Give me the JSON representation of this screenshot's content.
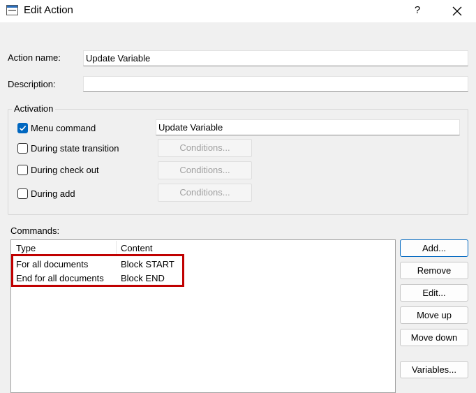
{
  "window": {
    "title": "Edit Action",
    "help_glyph": "?",
    "close_glyph": "✕"
  },
  "form": {
    "action_name_label": "Action name:",
    "action_name_value": "Update Variable",
    "description_label": "Description:",
    "description_value": ""
  },
  "activation": {
    "caption": "Activation",
    "items": [
      {
        "label": "Menu command",
        "checked": true
      },
      {
        "label": "During state transition",
        "checked": false,
        "button": "Conditions..."
      },
      {
        "label": "During check out",
        "checked": false,
        "button": "Conditions..."
      },
      {
        "label": "During add",
        "checked": false,
        "button": "Conditions..."
      }
    ],
    "menu_command_value": "Update Variable"
  },
  "commands": {
    "label": "Commands:",
    "columns": [
      "Type",
      "Content"
    ],
    "rows": [
      {
        "type": "For all documents",
        "content": "Block START"
      },
      {
        "type": "End for all documents",
        "content": "Block END"
      }
    ]
  },
  "buttons": {
    "add": "Add...",
    "remove": "Remove",
    "edit": "Edit...",
    "move_up": "Move up",
    "move_down": "Move down",
    "variables": "Variables..."
  },
  "colors": {
    "accent": "#0067c0",
    "highlight_border": "#c00000"
  }
}
